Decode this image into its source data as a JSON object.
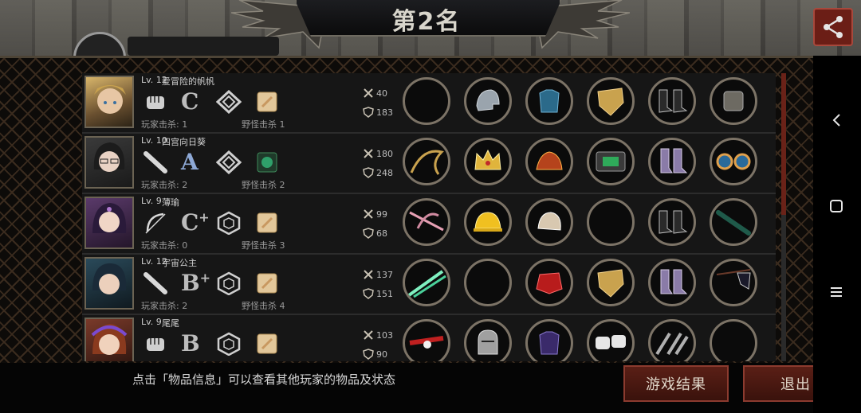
{
  "header": {
    "title": "第2名"
  },
  "players": [
    {
      "level": "Lv. 12",
      "name": "爱冒险的帆帆",
      "rank": "C",
      "player_kills": "玩家击杀: 1",
      "monster_kills": "野怪击杀 1",
      "atk": "40",
      "def": "183"
    },
    {
      "level": "Lv. 10",
      "name": "四宫向日葵",
      "rank": "A",
      "player_kills": "玩家击杀: 2",
      "monster_kills": "野怪击杀 2",
      "atk": "180",
      "def": "248"
    },
    {
      "level": "Lv. 9",
      "name": "薄瑜",
      "rank": "C",
      "rank_sup": "+",
      "player_kills": "玩家击杀: 0",
      "monster_kills": "野怪击杀 3",
      "atk": "99",
      "def": "68"
    },
    {
      "level": "Lv. 12",
      "name": "宇宙公主",
      "rank": "B",
      "rank_sup": "+",
      "player_kills": "玩家击杀: 2",
      "monster_kills": "野怪击杀 4",
      "atk": "137",
      "def": "151"
    },
    {
      "level": "Lv. 9",
      "name": "尾尾",
      "rank": "B",
      "player_kills": "",
      "monster_kills": "",
      "atk": "103",
      "def": "90"
    }
  ],
  "footer": {
    "hint": "点击「物品信息」可以查看其他玩家的物品及状态",
    "result_button": "游戏结果",
    "exit_button": "退出"
  },
  "colors": {
    "accent": "#6b1e16",
    "frame": "#7c7366"
  }
}
